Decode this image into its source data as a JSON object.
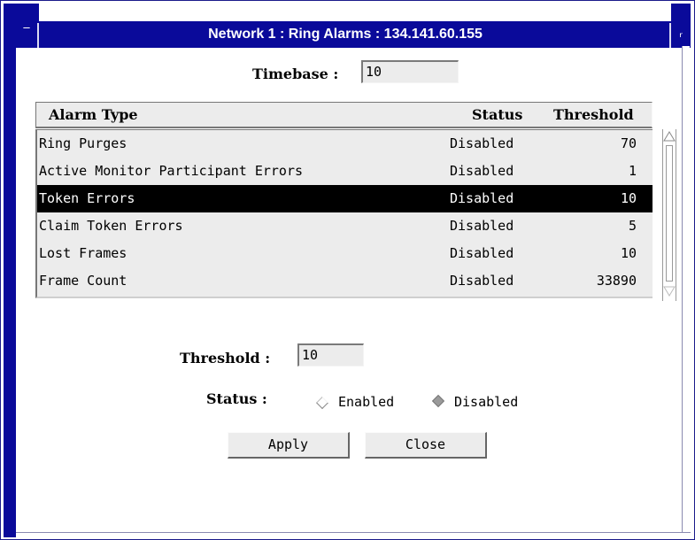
{
  "window": {
    "title": "Network 1 : Ring Alarms : 134.141.60.155",
    "left_button_glyph": "‾",
    "right_button_glyph": "ᵣ"
  },
  "timebase": {
    "label": "Timebase :",
    "value": "10"
  },
  "table": {
    "columns": [
      "Alarm Type",
      "Status",
      "Threshold"
    ],
    "rows": [
      {
        "type": "Ring Purges",
        "status": "Disabled",
        "threshold": "70"
      },
      {
        "type": "Active Monitor Participant Errors",
        "status": "Disabled",
        "threshold": "1"
      },
      {
        "type": "Token Errors",
        "status": "Disabled",
        "threshold": "10"
      },
      {
        "type": "Claim Token Errors",
        "status": "Disabled",
        "threshold": "5"
      },
      {
        "type": "Lost Frames",
        "status": "Disabled",
        "threshold": "10"
      },
      {
        "type": "Frame Count",
        "status": "Disabled",
        "threshold": "33890"
      }
    ],
    "selected_row": 2
  },
  "threshold": {
    "label": "Threshold :",
    "value": "10"
  },
  "status": {
    "label": "Status :",
    "options": [
      "Enabled",
      "Disabled"
    ],
    "selected": "Disabled"
  },
  "buttons": {
    "apply": "Apply",
    "close": "Close"
  },
  "colors": {
    "title_bar": "#0a0a9a",
    "panel": "#ececec",
    "selection": "#000000"
  }
}
